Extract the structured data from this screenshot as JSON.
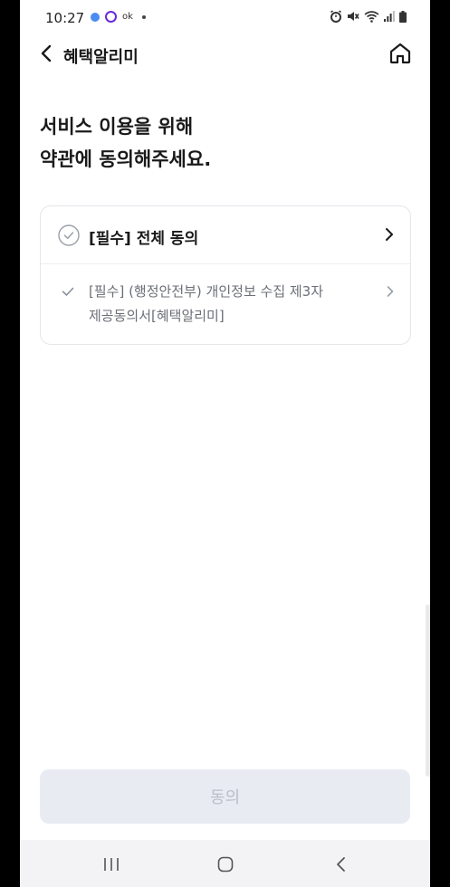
{
  "status_bar": {
    "time": "10:27",
    "ok_text": "ok",
    "icons": [
      "alarm-icon",
      "mute-icon",
      "wifi-icon",
      "signal-icon",
      "battery-icon"
    ]
  },
  "header": {
    "title": "혜택알리미",
    "back_icon": "chevron-left-icon",
    "home_icon": "home-icon"
  },
  "heading": {
    "line1": "서비스 이용을 위해",
    "line2": "약관에 동의해주세요."
  },
  "consent": {
    "all_label": "[필수] 전체 동의",
    "items": [
      {
        "label": "[필수] (행정안전부) 개인정보 수집 제3자 제공동의서[혜택알리미]"
      }
    ]
  },
  "agree_button": {
    "label": "동의"
  },
  "colors": {
    "button_bg": "#e8ebf2",
    "button_text": "#b9bec8",
    "text_primary": "#1a1a1a",
    "text_secondary": "#6b6f76"
  }
}
